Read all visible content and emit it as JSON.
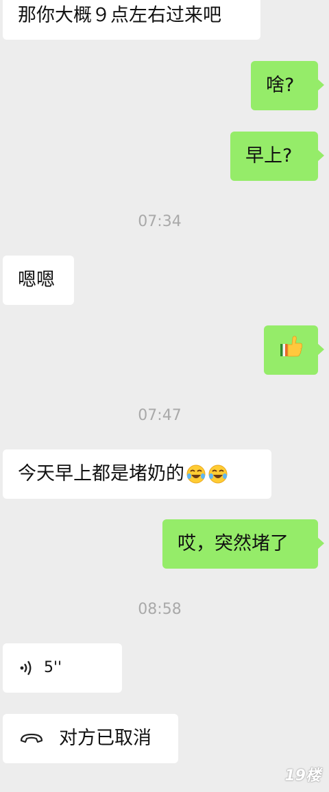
{
  "messages": [
    {
      "text": "那你大概９点左右过来吧"
    },
    {
      "text": "啥?"
    },
    {
      "text": "早上?"
    },
    {
      "time": "07:34"
    },
    {
      "text": "嗯嗯"
    },
    {
      "emoji": "thumbs-up"
    },
    {
      "time": "07:47"
    },
    {
      "text": "今天早上都是堵奶的",
      "emoji": [
        "laughing-crying-face",
        "laughing-crying-face"
      ]
    },
    {
      "text": "哎，突然堵了"
    },
    {
      "time": "08:58"
    },
    {
      "voice_duration": "5''",
      "icon": "voice-icon"
    },
    {
      "call_status": "对方已取消",
      "icon": "phone-icon"
    }
  ],
  "watermark": "19楼",
  "colors": {
    "background": "#ededed",
    "incoming_bubble": "#ffffff",
    "outgoing_bubble": "#95ec69",
    "timestamp": "#a9a9a9"
  }
}
